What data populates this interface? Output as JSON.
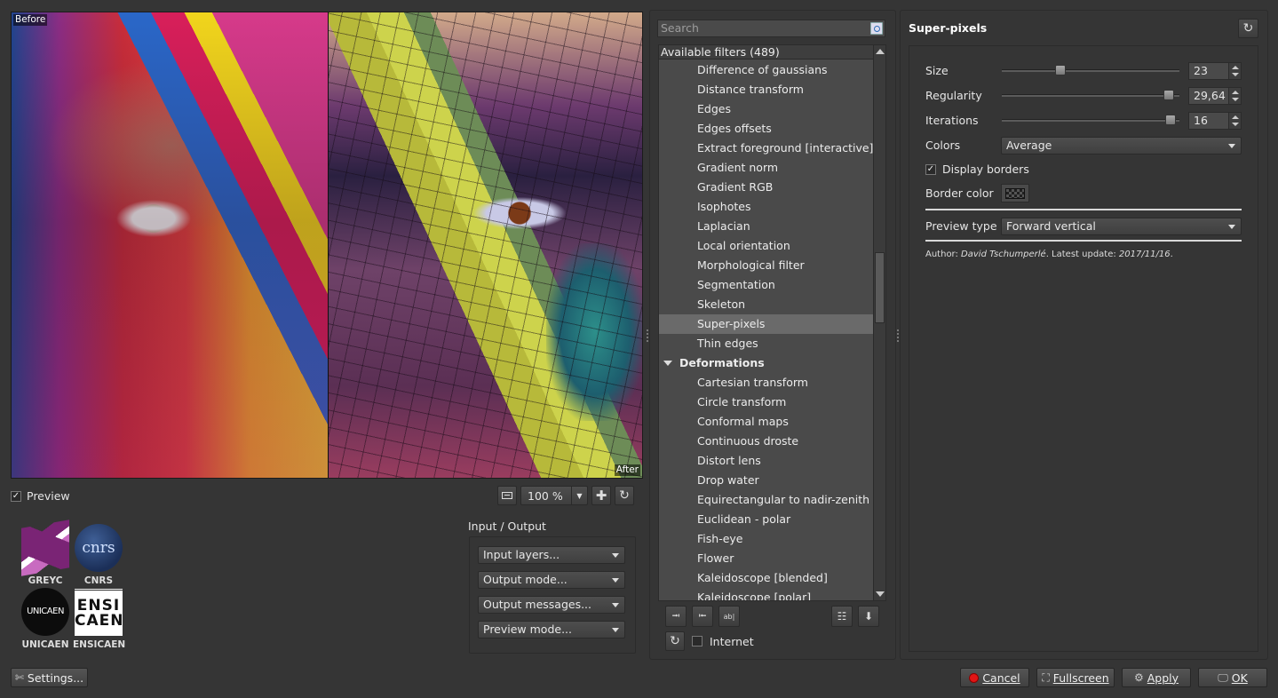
{
  "preview": {
    "before_label": "Before",
    "after_label": "After",
    "preview_label": "Preview",
    "preview_checked": "✓",
    "zoom": "100 %"
  },
  "logos": {
    "greyc": "GREYC",
    "cnrs": "CNRS",
    "cnrs_mark": "cnrs",
    "unicaen": "UNICAEN",
    "unicaen_mark": "UNICAEN",
    "ensicaen": "ENSICAEN",
    "ensicaen_mark_1": "ENSI",
    "ensicaen_mark_2": "CAEN"
  },
  "io": {
    "title": "Input / Output",
    "input_layers": "Input layers...",
    "output_mode": "Output mode...",
    "output_messages": "Output messages...",
    "preview_mode": "Preview mode..."
  },
  "filters": {
    "search_placeholder": "Search",
    "header": "Available filters (489)",
    "items": [
      {
        "label": "Difference of gaussians"
      },
      {
        "label": "Distance transform"
      },
      {
        "label": "Edges"
      },
      {
        "label": "Edges offsets"
      },
      {
        "label": "Extract foreground [interactive]"
      },
      {
        "label": "Gradient norm"
      },
      {
        "label": "Gradient RGB"
      },
      {
        "label": "Isophotes"
      },
      {
        "label": "Laplacian"
      },
      {
        "label": "Local orientation"
      },
      {
        "label": "Morphological filter"
      },
      {
        "label": "Segmentation"
      },
      {
        "label": "Skeleton"
      },
      {
        "label": "Super-pixels",
        "selected": true
      },
      {
        "label": "Thin edges"
      },
      {
        "label": "Deformations",
        "category": true
      },
      {
        "label": "Cartesian transform"
      },
      {
        "label": "Circle transform"
      },
      {
        "label": "Conformal maps"
      },
      {
        "label": "Continuous droste"
      },
      {
        "label": "Distort lens"
      },
      {
        "label": "Drop water"
      },
      {
        "label": "Equirectangular to nadir-zenith"
      },
      {
        "label": "Euclidean - polar"
      },
      {
        "label": "Fish-eye"
      },
      {
        "label": "Flower"
      },
      {
        "label": "Kaleidoscope [blended]"
      },
      {
        "label": "Kaleidoscope [polar]"
      }
    ],
    "internet_label": "Internet"
  },
  "filter_panel": {
    "title": "Super-pixels",
    "size_label": "Size",
    "size_value": "23",
    "size_fraction": 0.32,
    "regularity_label": "Regularity",
    "regularity_value": "29,64",
    "regularity_fraction": 0.97,
    "iterations_label": "Iterations",
    "iterations_value": "16",
    "iterations_fraction": 0.98,
    "colors_label": "Colors",
    "colors_value": "Average",
    "display_borders_label": "Display borders",
    "display_borders_checked": "✓",
    "border_color_label": "Border color",
    "preview_type_label": "Preview type",
    "preview_type_value": "Forward vertical",
    "author_prefix": "Author: ",
    "author_name": "David Tschumperlé",
    "update_prefix": ". Latest update: ",
    "update_date": "2017/11/16",
    "update_suffix": "."
  },
  "buttons": {
    "settings": "Settings...",
    "cancel": "Cancel",
    "fullscreen": "Fullscreen",
    "apply": "Apply",
    "ok": "OK"
  }
}
